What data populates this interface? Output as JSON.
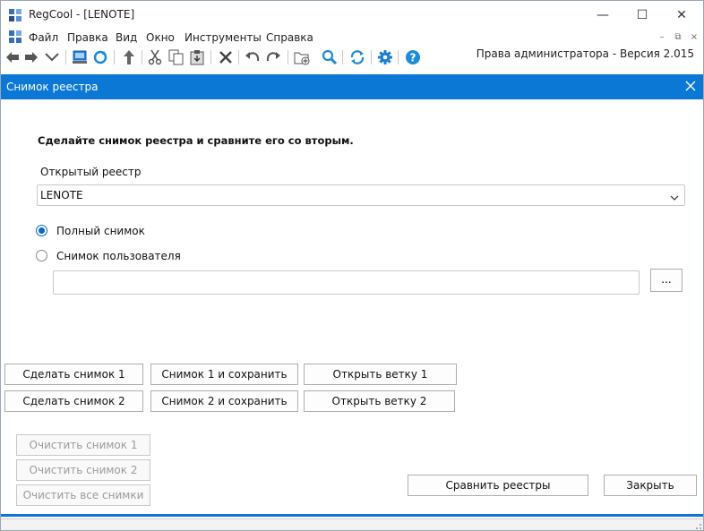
{
  "window": {
    "title": "RegCool - [LENOTE]",
    "controls": [
      "—",
      "☐",
      "✕"
    ]
  },
  "menu": {
    "items": [
      "Файл",
      "Правка",
      "Вид",
      "Окно",
      "Инструменты",
      "Справка"
    ],
    "mdi_controls": [
      "–",
      "⧉",
      "×"
    ]
  },
  "toolbar": {
    "icons": [
      "back-arrow-icon",
      "forward-arrow-icon",
      "dropdown-chevron-icon",
      "computer-icon",
      "refresh-icon",
      "up-arrow-icon",
      "cut-icon",
      "copy-icon",
      "paste-icon",
      "delete-icon",
      "undo-icon",
      "redo-icon",
      "new-key-icon",
      "search-icon",
      "sync-icon",
      "settings-icon",
      "help-icon"
    ],
    "admin_version": "Права администратора - Версия 2.015"
  },
  "dialog": {
    "title": "Снимок реестра",
    "heading": "Сделайте снимок реестра и сравните его со вторым.",
    "open_registry_label": "Открытый реестр",
    "registry_value": "LENOTE",
    "radio_full": "Полный снимок",
    "radio_user": "Снимок пользователя",
    "radio_selected": "full",
    "path_value": "",
    "browse_label": "...",
    "buttons": {
      "snapshot1": "Сделать снимок 1",
      "snapshot1_save": "Снимок 1 и сохранить",
      "open_branch1": "Открыть ветку 1",
      "snapshot2": "Сделать снимок 2",
      "snapshot2_save": "Снимок 2 и сохранить",
      "open_branch2": "Открыть ветку 2",
      "clear1": "Очистить снимок 1",
      "clear2": "Очистить снимок 2",
      "clear_all": "Очистить все снимки",
      "compare": "Сравнить реестры",
      "close": "Закрыть"
    }
  },
  "colors": {
    "accent": "#0a78d4",
    "radio": "#0a66c2",
    "disabled_text": "#9a9a9a"
  }
}
